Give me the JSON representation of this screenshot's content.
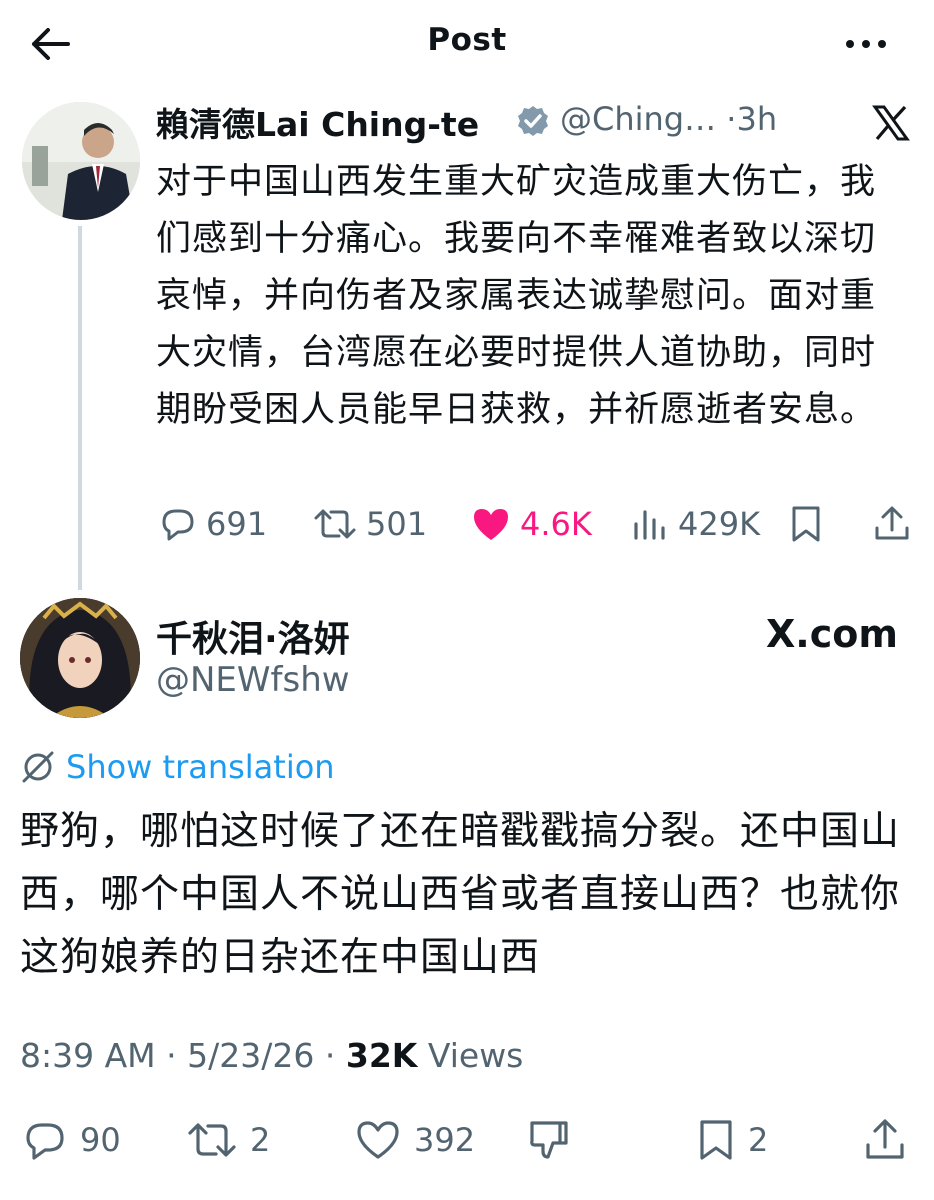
{
  "header": {
    "title": "Post",
    "back_icon": "arrow-left-icon",
    "more_icon": "more-horizontal-icon"
  },
  "quoted_post": {
    "author_name": "賴清德Lai Ching-te",
    "verified": true,
    "handle": "@Ching…",
    "separator": "·",
    "time": "3h",
    "source_icon": "x-logo-icon",
    "text": "对于中国山西发生重大矿灾造成重大伤亡，我们感到十分痛心。我要向不幸罹难者致以深切哀悼，并向伤者及家属表达诚挚慰问。面对重大灾情，台湾愿在必要时提供人道协助，同时期盼受困人员能早日获救，并祈愿逝者安息。",
    "metrics": {
      "replies": "691",
      "reposts": "501",
      "likes": "4.6K",
      "views": "429K"
    },
    "like_color": "#f91880"
  },
  "main_post": {
    "author_name": "千秋泪·洛妍",
    "handle": "@NEWfshw",
    "source_label": "X.com",
    "translate_label": "Show translation",
    "text": "野狗，哪怕这时候了还在暗戳戳搞分裂。还中国山西，哪个中国人不说山西省或者直接山西？也就你这狗娘养的日杂还在中国山西",
    "time": "8:39 AM",
    "date": "5/23/26",
    "separator": "·",
    "views_count": "32K",
    "views_label": "Views",
    "metrics": {
      "replies": "90",
      "reposts": "2",
      "likes": "392",
      "bookmarks": "2"
    }
  },
  "colors": {
    "text": "#0f1419",
    "secondary": "#536471",
    "link": "#1d9bf0",
    "verified": "#829aab"
  }
}
